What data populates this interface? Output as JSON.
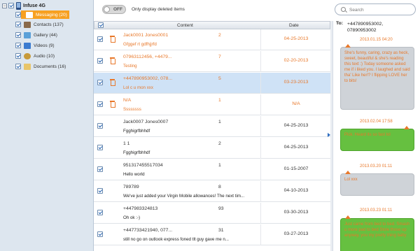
{
  "sidebar": {
    "device": {
      "label": "Infuse 4G",
      "toggle_glyph": "−",
      "icon": "phone-icon"
    },
    "categories": [
      {
        "label": "Messaging (20)",
        "icon": "messaging-icon",
        "icon_color": "#f29b1c",
        "selected": true
      },
      {
        "label": "Contacts (137)",
        "icon": "contacts-icon",
        "icon_color": "#8a6a4a"
      },
      {
        "label": "Gallery (44)",
        "icon": "gallery-icon",
        "icon_color": "#5aa0d8"
      },
      {
        "label": "Videos (9)",
        "icon": "videos-icon",
        "icon_color": "#3b7bd0"
      },
      {
        "label": "Audio (10)",
        "icon": "audio-icon",
        "icon_color": "#c79a3a"
      },
      {
        "label": "Documents (16)",
        "icon": "documents-icon",
        "icon_color": "#e8c56a"
      }
    ]
  },
  "topbar": {
    "toggle_state": "OFF",
    "toggle_label": "Only display deleted items",
    "search_placeholder": "Search"
  },
  "table": {
    "headers": {
      "content": "Content",
      "date": "Date"
    },
    "rows": [
      {
        "name": "Jack0001   Jones0001",
        "count": "2",
        "preview": "Gfggef rt gdfhjjrfd",
        "date": "04-25-2013",
        "deleted": true,
        "unread": true
      },
      {
        "name": "07963112456, +4479...",
        "count": "7",
        "preview": "Testing",
        "date": "02-20-2013",
        "deleted": true,
        "unread": true
      },
      {
        "name": "+447890953002, 078...",
        "count": "5",
        "preview": "Lol c u mon xxx",
        "date": "03-23-2013",
        "deleted": true,
        "unread": true,
        "selected": true
      },
      {
        "name": "N/A",
        "count": "1",
        "preview": "Ssssssss",
        "date": "N/A",
        "deleted": true,
        "unread": true
      },
      {
        "name": "Jack0007   Jones0007",
        "count": "1",
        "preview": "Fgghigrfbhhdf",
        "date": "04-25-2013"
      },
      {
        "name": "1 1",
        "count": "2",
        "preview": "Fgghigrfbhhdf",
        "date": "04-25-2013"
      },
      {
        "name": "951317455517034",
        "count": "1",
        "preview": "Hello world",
        "date": "01-15-2007"
      },
      {
        "name": "789789",
        "count": "8",
        "preview": "We've just added your Virgin Mobile allowances! The next tim...",
        "date": "04-10-2013"
      },
      {
        "name": "+447983324813",
        "count": "93",
        "preview": "Oh ok :-)",
        "date": "03-30-2013"
      },
      {
        "name": "+447733421940, 077...",
        "count": "31",
        "preview": "still no go on outlook express foned tlt guy gave me n...",
        "date": "03-27-2013"
      }
    ]
  },
  "conversation": {
    "to_label": "To:",
    "recipients": [
      "+447890953002,",
      "07890953002"
    ],
    "messages": [
      {
        "timestamp": "2013.01.15 04:20",
        "text": "She's funny, caring, crazy as heck, sweet, beautiful & she's reading this text :) Today someone asked me if i liked you. I laughed and said tha' Like her!? I flipping LOVE her to bits!",
        "type": "grey"
      },
      {
        "timestamp": "2013.02.04 17:58",
        "text": "Pick. Heard its so fast lol",
        "type": "green"
      },
      {
        "timestamp": "2013.03.20 01:11",
        "text": "Lol xxx",
        "type": "grey"
      },
      {
        "timestamp": "2013.03.23 01:11",
        "text": "Just came from bed to bed. Smash u more pad to bed Stole those up anyway, you my pretty thing baby",
        "type": "green"
      }
    ]
  },
  "colors": {
    "accent_orange": "#e8782a",
    "selected_row": "#cfe2f6",
    "sidebar_bg": "#dde6ef",
    "bubble_grey": "#cfd3d8",
    "bubble_green": "#66c040"
  }
}
